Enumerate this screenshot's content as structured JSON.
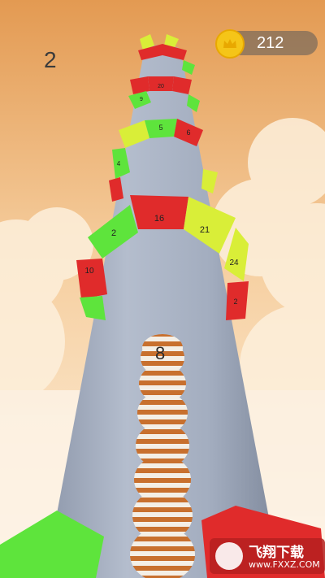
{
  "hud": {
    "level": "2",
    "coins": "212",
    "coin_icon": "crown-coin-icon"
  },
  "ball_stack": {
    "count": "8"
  },
  "rings": [
    {
      "segments": [
        "16",
        "21",
        "24",
        "2",
        "10",
        "2"
      ]
    },
    {
      "segments": [
        "5",
        "6",
        "4"
      ]
    },
    {
      "segments": [
        "20",
        "9"
      ]
    }
  ],
  "watermark": {
    "brand": "飞翔下载",
    "url": "www.FXXZ.COM"
  },
  "colors": {
    "sky_top": "#e8a45e",
    "sky_bottom": "#fbe7c9",
    "pillar": "#aab4c6",
    "segment_red": "#e02b2b",
    "segment_green": "#5ee43c",
    "segment_yellow": "#d9ee38",
    "ball_orange": "#c86a2a",
    "ball_white": "#f4f1ec",
    "coin": "#f5c518"
  }
}
